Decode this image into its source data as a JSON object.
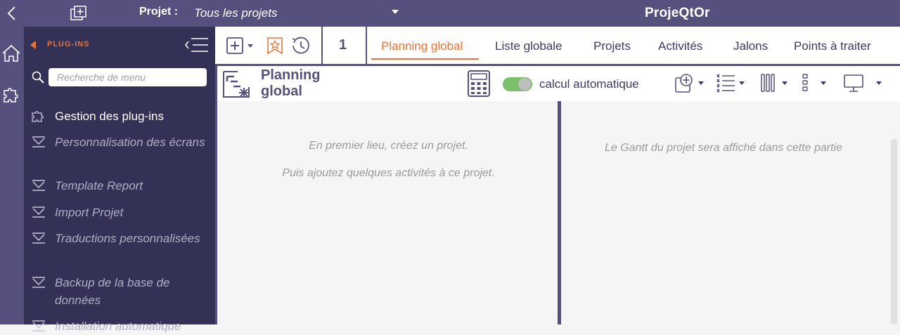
{
  "topbar": {
    "project_label": "Projet :",
    "project_value": "Tous les projets",
    "app_title": "ProjeQtOr"
  },
  "menu": {
    "section_label": "PLUG-INS",
    "search_placeholder": "Recherche de menu",
    "items": [
      {
        "label": "Gestion des plug-ins",
        "icon": "puzzle-icon",
        "active": true
      },
      {
        "label": "Personnalisation des écrans",
        "icon": "install-icon"
      },
      {
        "label": "Template Report",
        "icon": "install-icon"
      },
      {
        "label": "Import Projet",
        "icon": "install-icon"
      },
      {
        "label": "Traductions personnalisées",
        "icon": "install-icon"
      },
      {
        "label": "Backup de la base de données",
        "icon": "install-icon"
      },
      {
        "label": "Installation automatique",
        "icon": "install-icon"
      }
    ]
  },
  "toolbar": {
    "count": "1",
    "tabs": [
      {
        "label": "Planning global",
        "active": true
      },
      {
        "label": "Liste globale"
      },
      {
        "label": "Projets"
      },
      {
        "label": "Activités"
      },
      {
        "label": "Jalons"
      },
      {
        "label": "Points à traiter"
      }
    ]
  },
  "panel": {
    "title": "Planning global",
    "auto_calc_label": "calcul automatique",
    "auto_calc_on": true
  },
  "content": {
    "left_msg_1": "En premier lieu, créez un projet.",
    "left_msg_2": "Puis ajoutez quelques activités à ce projet.",
    "right_msg": "Le Gantt du projet sera affiché dans cette partie"
  },
  "colors": {
    "brand": "#55507e",
    "menu_bg": "#333155",
    "accent": "#e5743a",
    "toggle_on": "#7bbf6a"
  }
}
